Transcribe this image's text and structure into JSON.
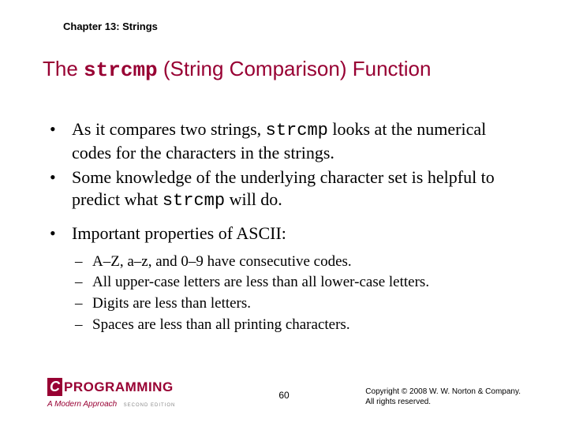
{
  "chapter_header": "Chapter 13: Strings",
  "title": {
    "pre": "The ",
    "code": "strcmp",
    "post": " (String Comparison) Function"
  },
  "bullets": [
    {
      "pre": "As it compares two strings, ",
      "code": "strcmp",
      "post": " looks at the numerical codes for the characters in the strings."
    },
    {
      "pre": "Some knowledge of the underlying character set is helpful to predict what ",
      "code": "strcmp",
      "post": " will do."
    },
    {
      "pre": "Important properties of ASCII:",
      "code": "",
      "post": ""
    }
  ],
  "subbullets": [
    "A–Z, a–z, and 0–9 have consecutive codes.",
    "All upper-case letters are less than all lower-case letters.",
    "Digits are less than letters.",
    "Spaces are less than all printing characters."
  ],
  "logo": {
    "c": "C",
    "prog": "PROGRAMMING",
    "sub": "A Modern Approach",
    "ed": "SECOND EDITION"
  },
  "page_num": "60",
  "copyright_line1": "Copyright © 2008 W. W. Norton & Company.",
  "copyright_line2": "All rights reserved."
}
